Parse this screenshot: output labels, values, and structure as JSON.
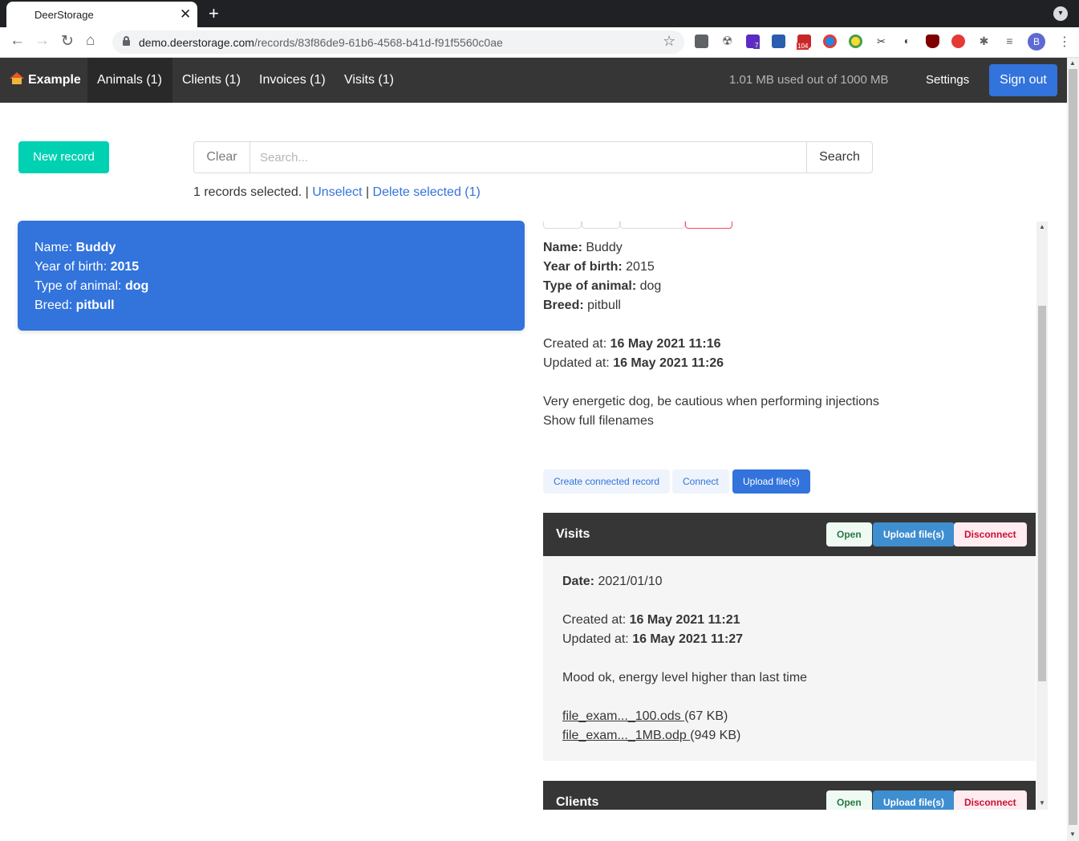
{
  "browser": {
    "tab_title": "DeerStorage",
    "tab_close": "✕",
    "new_tab": "+",
    "url_host": "demo.deerstorage.com",
    "url_path": "/records/83f86de9-61b6-4568-b41d-f91f5560c0ae",
    "profile_initial": "B",
    "extension_badges": {
      "one": "7",
      "two": "104"
    }
  },
  "navbar": {
    "brand": "Example",
    "items": [
      {
        "label": "Animals (1)",
        "active": true
      },
      {
        "label": "Clients (1)"
      },
      {
        "label": "Invoices (1)"
      },
      {
        "label": "Visits (1)"
      }
    ],
    "storage": "1.01 MB used out of 1000 MB",
    "settings": "Settings",
    "sign_out": "Sign out"
  },
  "controls": {
    "new_record": "New record",
    "clear": "Clear",
    "search_placeholder": "Search...",
    "search": "Search",
    "selected_text": "1 records selected. |",
    "unselect": "Unselect",
    "separator": "|",
    "delete_selected": "Delete selected (1)"
  },
  "card": {
    "name_label": "Name:",
    "name": "Buddy",
    "year_label": "Year of birth:",
    "year": "2015",
    "type_label": "Type of animal:",
    "type": "dog",
    "breed_label": "Breed:",
    "breed": "pitbull"
  },
  "detail": {
    "name_label": "Name:",
    "name": "Buddy",
    "year_label": "Year of birth:",
    "year": "2015",
    "type_label": "Type of animal:",
    "type": "dog",
    "breed_label": "Breed:",
    "breed": "pitbull",
    "created_label": "Created at:",
    "created": "16 May 2021 11:16",
    "updated_label": "Updated at:",
    "updated": "16 May 2021 11:26",
    "note": "Very energetic dog, be cautious when performing injections",
    "show_full": "Show full filenames",
    "create_connected": "Create connected record",
    "connect": "Connect",
    "upload": "Upload file(s)"
  },
  "visits": {
    "title": "Visits",
    "open": "Open",
    "upload": "Upload file(s)",
    "disconnect": "Disconnect",
    "date_label": "Date:",
    "date": "2021/01/10",
    "created_label": "Created at:",
    "created": "16 May 2021 11:21",
    "updated_label": "Updated at:",
    "updated": "16 May 2021 11:27",
    "note": "Mood ok, energy level higher than last time",
    "files": [
      {
        "name": "file_exam..._100.ods ",
        "size": "(67 KB)"
      },
      {
        "name": "file_exam..._1MB.odp ",
        "size": "(949 KB)"
      }
    ]
  },
  "clients": {
    "title": "Clients",
    "open": "Open",
    "upload": "Upload file(s)",
    "disconnect": "Disconnect"
  },
  "colors": {
    "primary": "#3273dc",
    "teal": "#00d1b2",
    "navbar": "#363636"
  }
}
